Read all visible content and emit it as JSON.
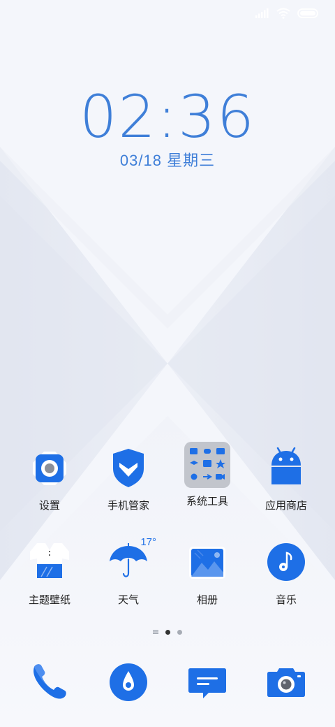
{
  "status_bar": {
    "icons": [
      "signal-icon",
      "wifi-icon",
      "battery-icon"
    ]
  },
  "lockclock": {
    "time": "02:36",
    "date": "03/18 星期三"
  },
  "home_apps": [
    {
      "label": "设置",
      "icon": "settings-icon"
    },
    {
      "label": "手机管家",
      "icon": "security-shield-icon"
    },
    {
      "label": "系统工具",
      "icon": "system-tools-folder-icon"
    },
    {
      "label": "应用商店",
      "icon": "android-store-icon"
    },
    {
      "label": "主题壁纸",
      "icon": "theme-shirt-icon"
    },
    {
      "label": "天气",
      "icon": "weather-umbrella-icon",
      "temperature": "17°"
    },
    {
      "label": "相册",
      "icon": "gallery-icon"
    },
    {
      "label": "音乐",
      "icon": "music-icon"
    }
  ],
  "page_indicator": {
    "pages": 3,
    "active": 1
  },
  "dock": [
    {
      "icon": "phone-icon"
    },
    {
      "icon": "browser-icon"
    },
    {
      "icon": "messages-icon"
    },
    {
      "icon": "camera-icon"
    }
  ],
  "colors": {
    "accent": "#1e6fe6",
    "clock_text": "#3f7fd8",
    "background": "#f3f5fa"
  }
}
